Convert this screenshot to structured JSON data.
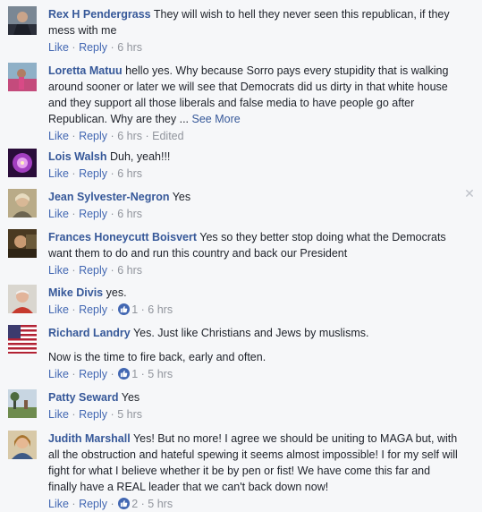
{
  "comments": [
    {
      "author": "Rex H Pendergrass",
      "text": "They will wish to hell they never seen this republican, if they mess with me",
      "like": "Like",
      "reply": "Reply",
      "time": "6 hrs"
    },
    {
      "author": "Loretta Matuu",
      "text": "hello yes. Why because Sorro pays every stupidity that is walking around sooner or later we will see that Democrats did us dirty in that white house and they support all those liberals and false media to have people go after Republican. Why are they ...",
      "see_more": "See More",
      "like": "Like",
      "reply": "Reply",
      "time": "6 hrs",
      "edited": "Edited"
    },
    {
      "author": "Lois Walsh",
      "text": "Duh, yeah!!!",
      "like": "Like",
      "reply": "Reply",
      "time": "6 hrs"
    },
    {
      "author": "Jean Sylvester-Negron",
      "text": "Yes",
      "like": "Like",
      "reply": "Reply",
      "time": "6 hrs"
    },
    {
      "author": "Frances Honeycutt Boisvert",
      "text": "Yes so they better stop doing what the Democrats want them to do and run this country and back our President",
      "like": "Like",
      "reply": "Reply",
      "time": "6 hrs"
    },
    {
      "author": "Mike Divis",
      "text": "yes.",
      "like": "Like",
      "reply": "Reply",
      "reactions": "1",
      "time": "6 hrs"
    },
    {
      "author": "Richard Landry",
      "text": "Yes. Just like Christians and Jews by muslisms.",
      "text2": "Now is the time to fire back, early and often.",
      "like": "Like",
      "reply": "Reply",
      "reactions": "1",
      "time": "5 hrs"
    },
    {
      "author": "Patty Seward",
      "text": "Yes",
      "like": "Like",
      "reply": "Reply",
      "time": "5 hrs"
    },
    {
      "author": "Judith Marshall",
      "text": "Yes! But no more! I agree we should be uniting to MAGA but, with all the obstruction and hateful spewing it seems almost impossible! I for my self will fight for what I believe whether it be by pen or fist! We have come this far and finally have a REAL leader that we can't back down now!",
      "like": "Like",
      "reply": "Reply",
      "reactions": "2",
      "time": "5 hrs"
    }
  ],
  "icons": {
    "close": "close-icon",
    "like_reaction": "thumbs-up-icon"
  },
  "colors": {
    "link": "#365899",
    "action_link": "#4267b2",
    "meta": "#90949c",
    "background": "#f6f7f9"
  }
}
